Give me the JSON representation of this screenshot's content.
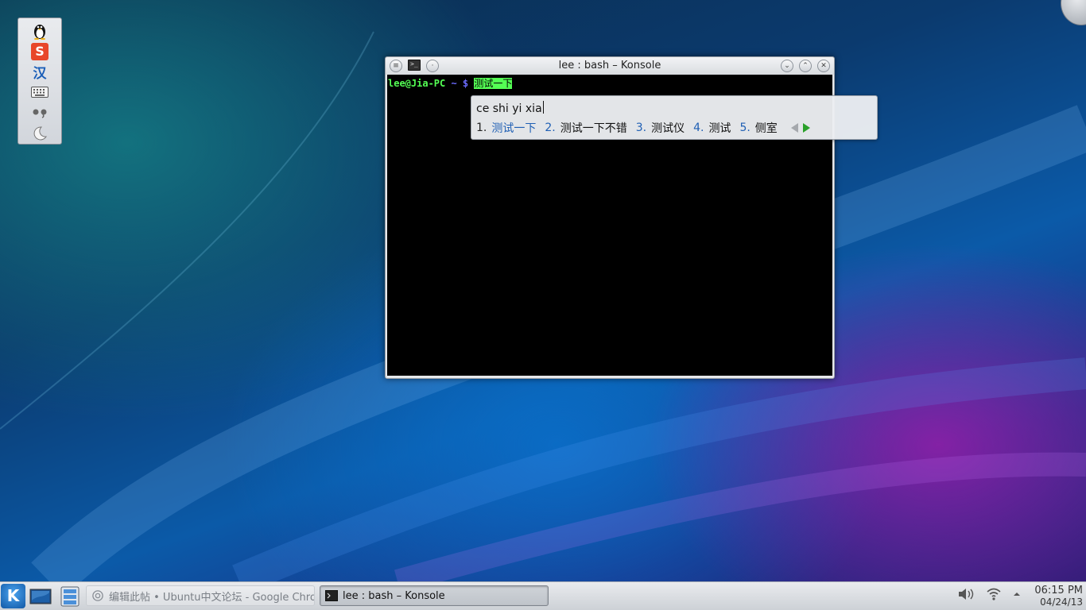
{
  "desktop": {
    "im_toolbar": {
      "items": [
        {
          "icon": "penguin-icon"
        },
        {
          "icon": "sogou-logo-icon",
          "glyph": "S"
        },
        {
          "icon": "chinese-mode-icon",
          "glyph": "汉"
        },
        {
          "icon": "keyboard-icon"
        },
        {
          "icon": "punctuation-icon"
        },
        {
          "icon": "halfwidth-moon-icon"
        }
      ]
    }
  },
  "konsole": {
    "title": "lee : bash – Konsole",
    "prompt_user_host": "lee@Jia-PC",
    "prompt_path": "~ $",
    "prompt_input": "测试一下"
  },
  "ime": {
    "preedit": "ce shi yi xia",
    "candidates": [
      {
        "index": "1.",
        "text": "测试一下",
        "selected": true
      },
      {
        "index": "2.",
        "text": "测试一下不错"
      },
      {
        "index": "3.",
        "text": "测试仪"
      },
      {
        "index": "4.",
        "text": "测试"
      },
      {
        "index": "5.",
        "text": "侧室"
      }
    ]
  },
  "taskbar": {
    "kickoff_glyph": "K",
    "tasks": [
      {
        "label": "编辑此帖 • Ubuntu中文论坛 - Google Chro",
        "active": false
      },
      {
        "label": "lee : bash – Konsole",
        "active": true
      }
    ],
    "clock_time": "06:15 PM",
    "clock_date": "04/24/13"
  },
  "colors": {
    "prompt_green": "#54ff54",
    "prompt_blue": "#6b6bff",
    "candidate_blue": "#1f5fb4",
    "next_arrow_green": "#2aa02a"
  }
}
